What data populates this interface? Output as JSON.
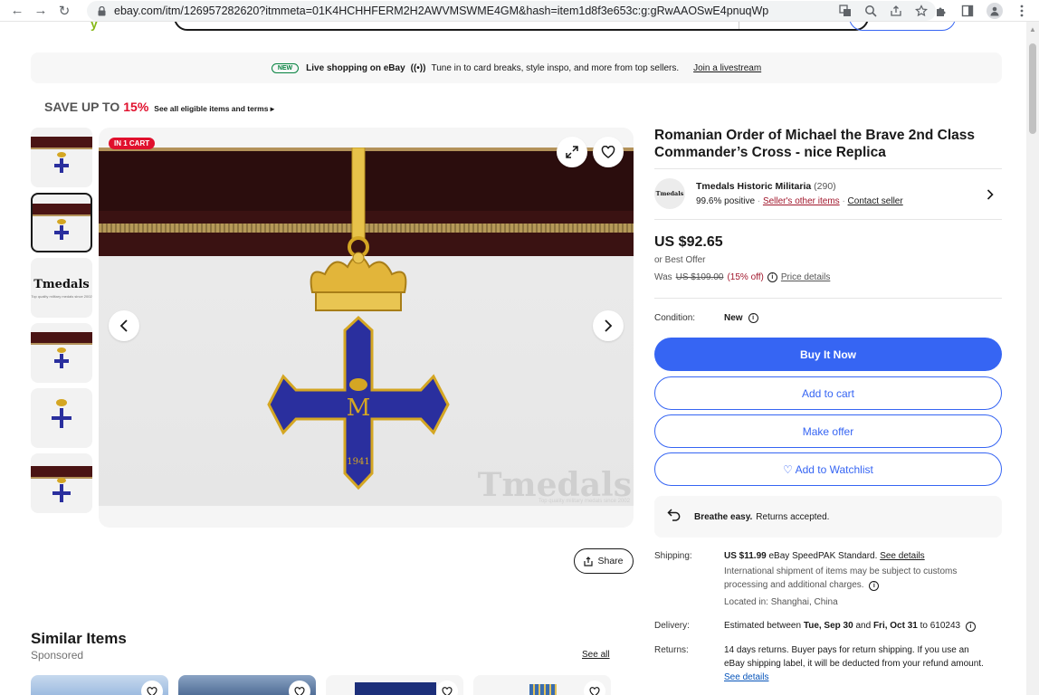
{
  "browser": {
    "url": "ebay.com/itm/126957282620?itmmeta=01K4HCHHFERM2H2AWVMSWME4GM&hash=item1d8f3e653c:g:gRwAAOSwE4pnuqWp"
  },
  "live_banner": {
    "pill": "NEW",
    "title": "Live shopping on eBay",
    "text": "Tune in to card breaks, style inspo, and more from top sellers.",
    "link": "Join a livestream"
  },
  "promo": {
    "save_text": "SAVE UP TO",
    "save_pct": "15%",
    "link": "See all eligible items and terms ▸"
  },
  "thumbnails": {
    "logo_text": "Tmedals",
    "logo_sub": "Top quality military medals since 2002"
  },
  "image": {
    "badge": "IN 1 CART",
    "watermark": "Tmedals",
    "watermark_sub": "Top quality military medals since 2002",
    "medal_year": "1941",
    "medal_monogram": "M"
  },
  "share_label": "Share",
  "similar": {
    "title": "Similar Items",
    "sponsored": "Sponsored",
    "see_all": "See all"
  },
  "item": {
    "title": "Romanian Order of Michael the Brave 2nd Class Commander’s Cross - nice Replica",
    "seller": {
      "avatar_text": "Tmedals",
      "name": "Tmedals Historic Militaria",
      "count": "(290)",
      "positive": "99.6% positive",
      "other_items": "Seller's other items",
      "contact": "Contact seller"
    },
    "price": "US $92.65",
    "best_offer": "or Best Offer",
    "was_label": "Was",
    "was_price": "US $109.00",
    "off": "(15% off)",
    "price_details": "Price details",
    "condition_label": "Condition:",
    "condition_value": "New"
  },
  "buttons": {
    "buy": "Buy It Now",
    "cart": "Add to cart",
    "offer": "Make offer",
    "watchlist": "♡ Add to Watchlist"
  },
  "breathe": {
    "bold": "Breathe easy.",
    "text": "Returns accepted."
  },
  "shipping": {
    "label": "Shipping:",
    "price": "US $11.99",
    "service": "eBay SpeedPAK Standard.",
    "see_details": "See details",
    "note": "International shipment of items may be subject to customs processing and additional charges.",
    "located": "Located in: Shanghai, China"
  },
  "delivery": {
    "label": "Delivery:",
    "prefix": "Estimated between",
    "start": "Tue, Sep 30",
    "and": "and",
    "end": "Fri, Oct 31",
    "to": "to 610243"
  },
  "returns": {
    "label": "Returns:",
    "text": "14 days returns. Buyer pays for return shipping. If you use an eBay shipping label, it will be deducted from your refund amount.",
    "see_details": "See details"
  },
  "colors": {
    "primary": "#3665f3",
    "red_badge": "#e0102d",
    "medal_blue": "#2a2f9e",
    "gold": "#d4a623"
  }
}
